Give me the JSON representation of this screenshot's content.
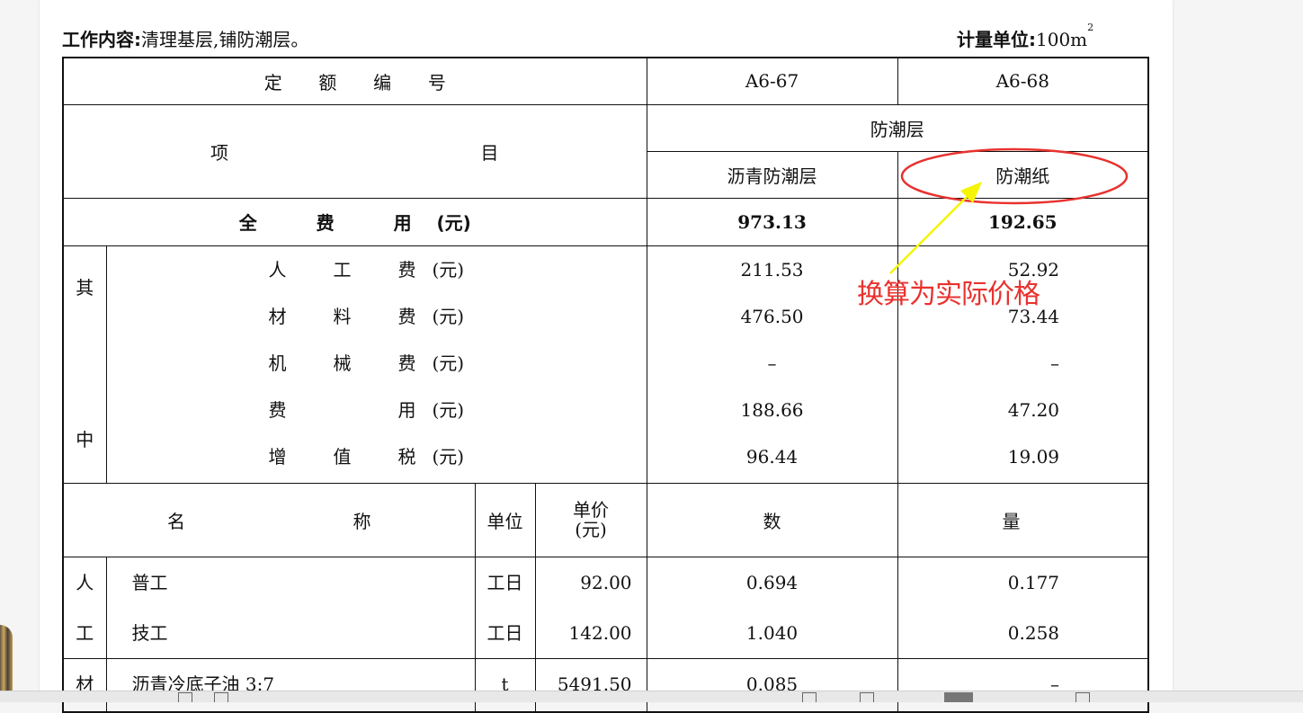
{
  "header": {
    "work_label": "工作内容:",
    "work_text": "清理基层,铺防潮层。",
    "unit_label": "计量单位:",
    "unit_value": "100m",
    "unit_sup": "2"
  },
  "table": {
    "code_label_chars": [
      "定",
      "额",
      "编",
      "号"
    ],
    "codes": [
      "A6-67",
      "A6-68"
    ],
    "item_label_left": "项",
    "item_label_right": "目",
    "group_header": "防潮层",
    "sub_headers": [
      "沥青防潮层",
      "防潮纸"
    ],
    "total_label_chars": [
      "全",
      "费",
      "用"
    ],
    "total_unit": "(元)",
    "total_values": [
      "973.13",
      "192.65"
    ],
    "among_chars": [
      "其",
      "中"
    ],
    "breakdown": [
      {
        "chars": [
          "人",
          "工",
          "费"
        ],
        "unit": "(元)",
        "a": "211.53",
        "b": "52.92"
      },
      {
        "chars": [
          "材",
          "料",
          "费"
        ],
        "unit": "(元)",
        "a": "476.50",
        "b": "73.44"
      },
      {
        "chars": [
          "机",
          "械",
          "费"
        ],
        "unit": "(元)",
        "a": "–",
        "b": "–"
      },
      {
        "chars": [
          "费",
          "",
          "用"
        ],
        "unit": "(元)",
        "a": "188.66",
        "b": "47.20"
      },
      {
        "chars": [
          "增",
          "值",
          "税"
        ],
        "unit": "(元)",
        "a": "96.44",
        "b": "19.09"
      }
    ],
    "res_header": {
      "name_left": "名",
      "name_right": "称",
      "unit": "单位",
      "price_line1": "单价",
      "price_line2": "(元)",
      "qty_left": "数",
      "qty_right": "量"
    },
    "labor_chars": [
      "人",
      "工"
    ],
    "labor_rows": [
      {
        "name": "普工",
        "unit": "工日",
        "price": "92.00",
        "a": "0.694",
        "b": "0.177"
      },
      {
        "name": "技工",
        "unit": "工日",
        "price": "142.00",
        "a": "1.040",
        "b": "0.258"
      }
    ],
    "material_char": "材",
    "material_rows": [
      {
        "name": "沥青冷底子油 3:7",
        "unit": "t",
        "price": "5491.50",
        "a": "0.085",
        "b": "–"
      }
    ]
  },
  "annotation": {
    "text": "换算为实际价格",
    "color": "#e8322e",
    "arrow_color": "#f5f500"
  }
}
